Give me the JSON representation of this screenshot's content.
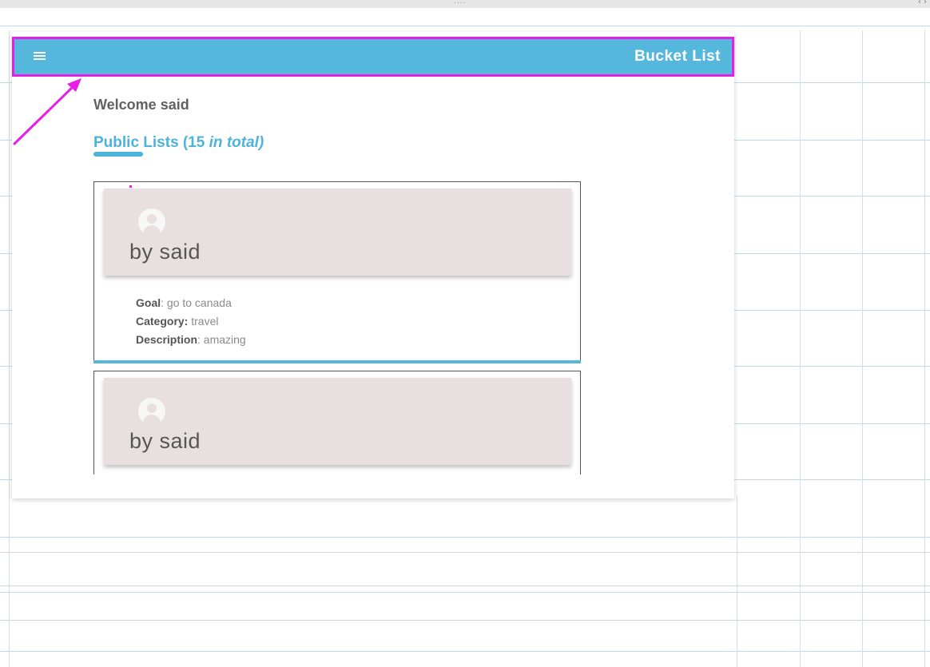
{
  "editor": {
    "grip": "....",
    "arrows": "‹ ›"
  },
  "app": {
    "title": "Bucket List",
    "menu_icon": "hamburger-menu-icon",
    "welcome": "Welcome said",
    "public_lists": {
      "label": "Public Lists (15 ",
      "count_suffix": "in total",
      "close": ")"
    },
    "cards": [
      {
        "author": "by said",
        "avatar_icon": "user-avatar-icon",
        "goal_label": "Goal",
        "goal": ": go to canada",
        "category_label": "Category:",
        "category": " travel",
        "description_label": "Description",
        "description": ": amazing"
      },
      {
        "author": "by said",
        "avatar_icon": "user-avatar-icon"
      }
    ]
  },
  "colors": {
    "appbar": "#55b7dc",
    "highlight": "#e61ee6",
    "card_header": "#e8e0e0",
    "heading": "#4db3da"
  }
}
